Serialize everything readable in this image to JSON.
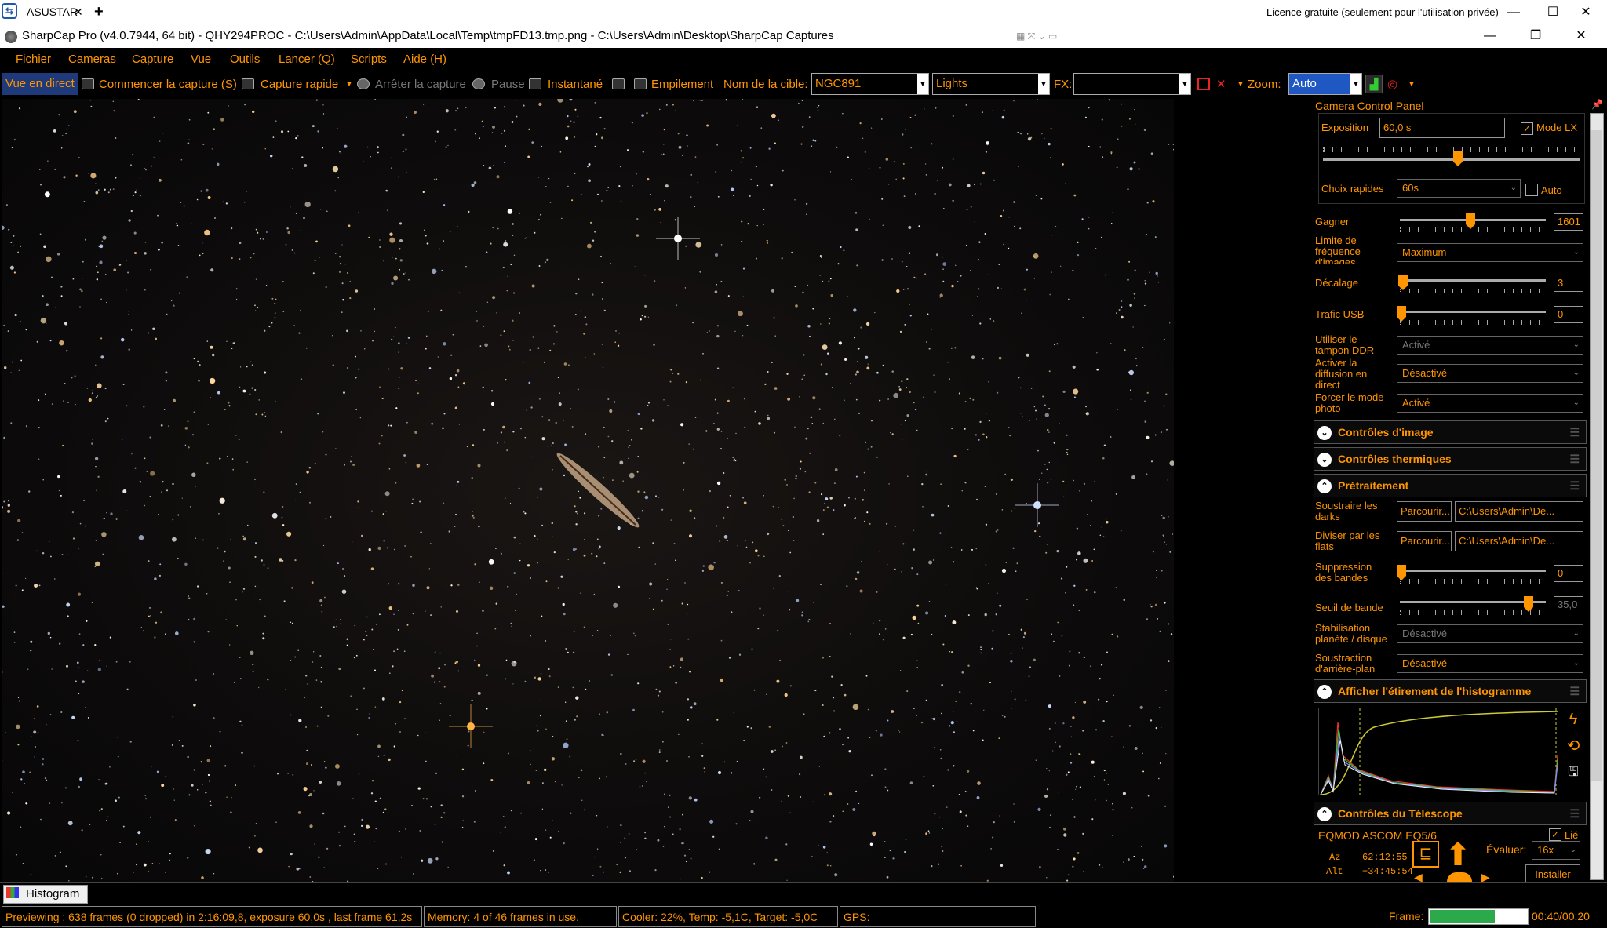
{
  "teamviewer": {
    "tab": "ASUSTAR",
    "license": "Licence gratuite (seulement pour l'utilisation privée)"
  },
  "window": {
    "title": "SharpCap Pro (v4.0.7944, 64 bit) - QHY294PROC - C:\\Users\\Admin\\AppData\\Local\\Temp\\tmpFD13.tmp.png - C:\\Users\\Admin\\Desktop\\SharpCap Captures"
  },
  "menu": [
    "Fichier",
    "Cameras",
    "Capture",
    "Vue",
    "Outils",
    "Lancer (Q)",
    "Scripts",
    "Aide (H)"
  ],
  "toolbar": {
    "live": "Vue en direct",
    "start_capture": "Commencer la capture (S)",
    "quick_capture": "Capture rapide",
    "stop_capture": "Arrêter la capture",
    "pause": "Pause",
    "snapshot": "Instantané",
    "stacking": "Empilement",
    "target_label": "Nom de la cible:",
    "target_value": "NGC891",
    "frame_type": "Lights",
    "fx_label": "FX:",
    "fx_value": "",
    "zoom_label": "Zoom:",
    "zoom_value": "Auto"
  },
  "panel": {
    "title": "Camera Control Panel",
    "exposure_label": "Exposition",
    "exposure_value": "60,0 s",
    "lx_mode_label": "Mode LX",
    "lx_mode_checked": true,
    "quick_choices_label": "Choix rapides",
    "quick_choices_value": "60s",
    "auto_label": "Auto",
    "gain_label": "Gagner",
    "gain_value": "1601",
    "frame_limit_label": "Limite de fréquence d'images",
    "frame_limit_value": "Maximum",
    "offset_label": "Décalage",
    "offset_value": "3",
    "usb_label": "Trafic USB",
    "usb_value": "0",
    "ddr_label": "Utiliser le tampon DDR",
    "ddr_value": "Activé",
    "live_stream_label": "Activer la diffusion en direct",
    "live_stream_value": "Désactivé",
    "force_photo_label": "Forcer le mode photo",
    "force_photo_value": "Activé",
    "image_controls": "Contrôles d'image",
    "thermal_controls": "Contrôles thermiques",
    "preprocessing": "Prétraitement",
    "subtract_darks_label": "Soustraire les darks",
    "browse": "Parcourir...",
    "darks_path": "C:\\Users\\Admin\\De...",
    "divide_flats_label": "Diviser par les flats",
    "flats_path": "C:\\Users\\Admin\\De...",
    "banding_label": "Suppression des bandes",
    "banding_value": "0",
    "band_threshold_label": "Seuil de bande",
    "band_threshold_value": "35,0",
    "stabilization_label": "Stabilisation planète / disque",
    "stabilization_value": "Désactivé",
    "bg_subtract_label": "Soustraction d'arrière-plan",
    "bg_subtract_value": "Désactivé",
    "histogram_stretch": "Afficher l'étirement de l'histogramme",
    "telescope_controls": "Contrôles du Télescope",
    "mount_name": "EQMOD ASCOM EQ5/6",
    "linked_label": "Lié",
    "az_label": "Az",
    "az_value": "62:12:55",
    "alt_label": "Alt",
    "alt_value": "+34:45:54",
    "rate_label": "Évaluer:",
    "rate_value": "16x",
    "install_label": "Installer"
  },
  "bottom": {
    "histogram_tab": "Histogram"
  },
  "status": {
    "preview": "Previewing : 638 frames (0 dropped) in 2:16:09,8, exposure 60,0s , last frame 61,2s",
    "memory": "Memory: 4 of 46 frames in use.",
    "cooler": "Cooler: 22%, Temp: -5,1C, Target: -5,0C",
    "gps": "GPS:",
    "frame_label": "Frame:",
    "frame_progress": 0.667,
    "frame_time": "00:40/00:20"
  }
}
